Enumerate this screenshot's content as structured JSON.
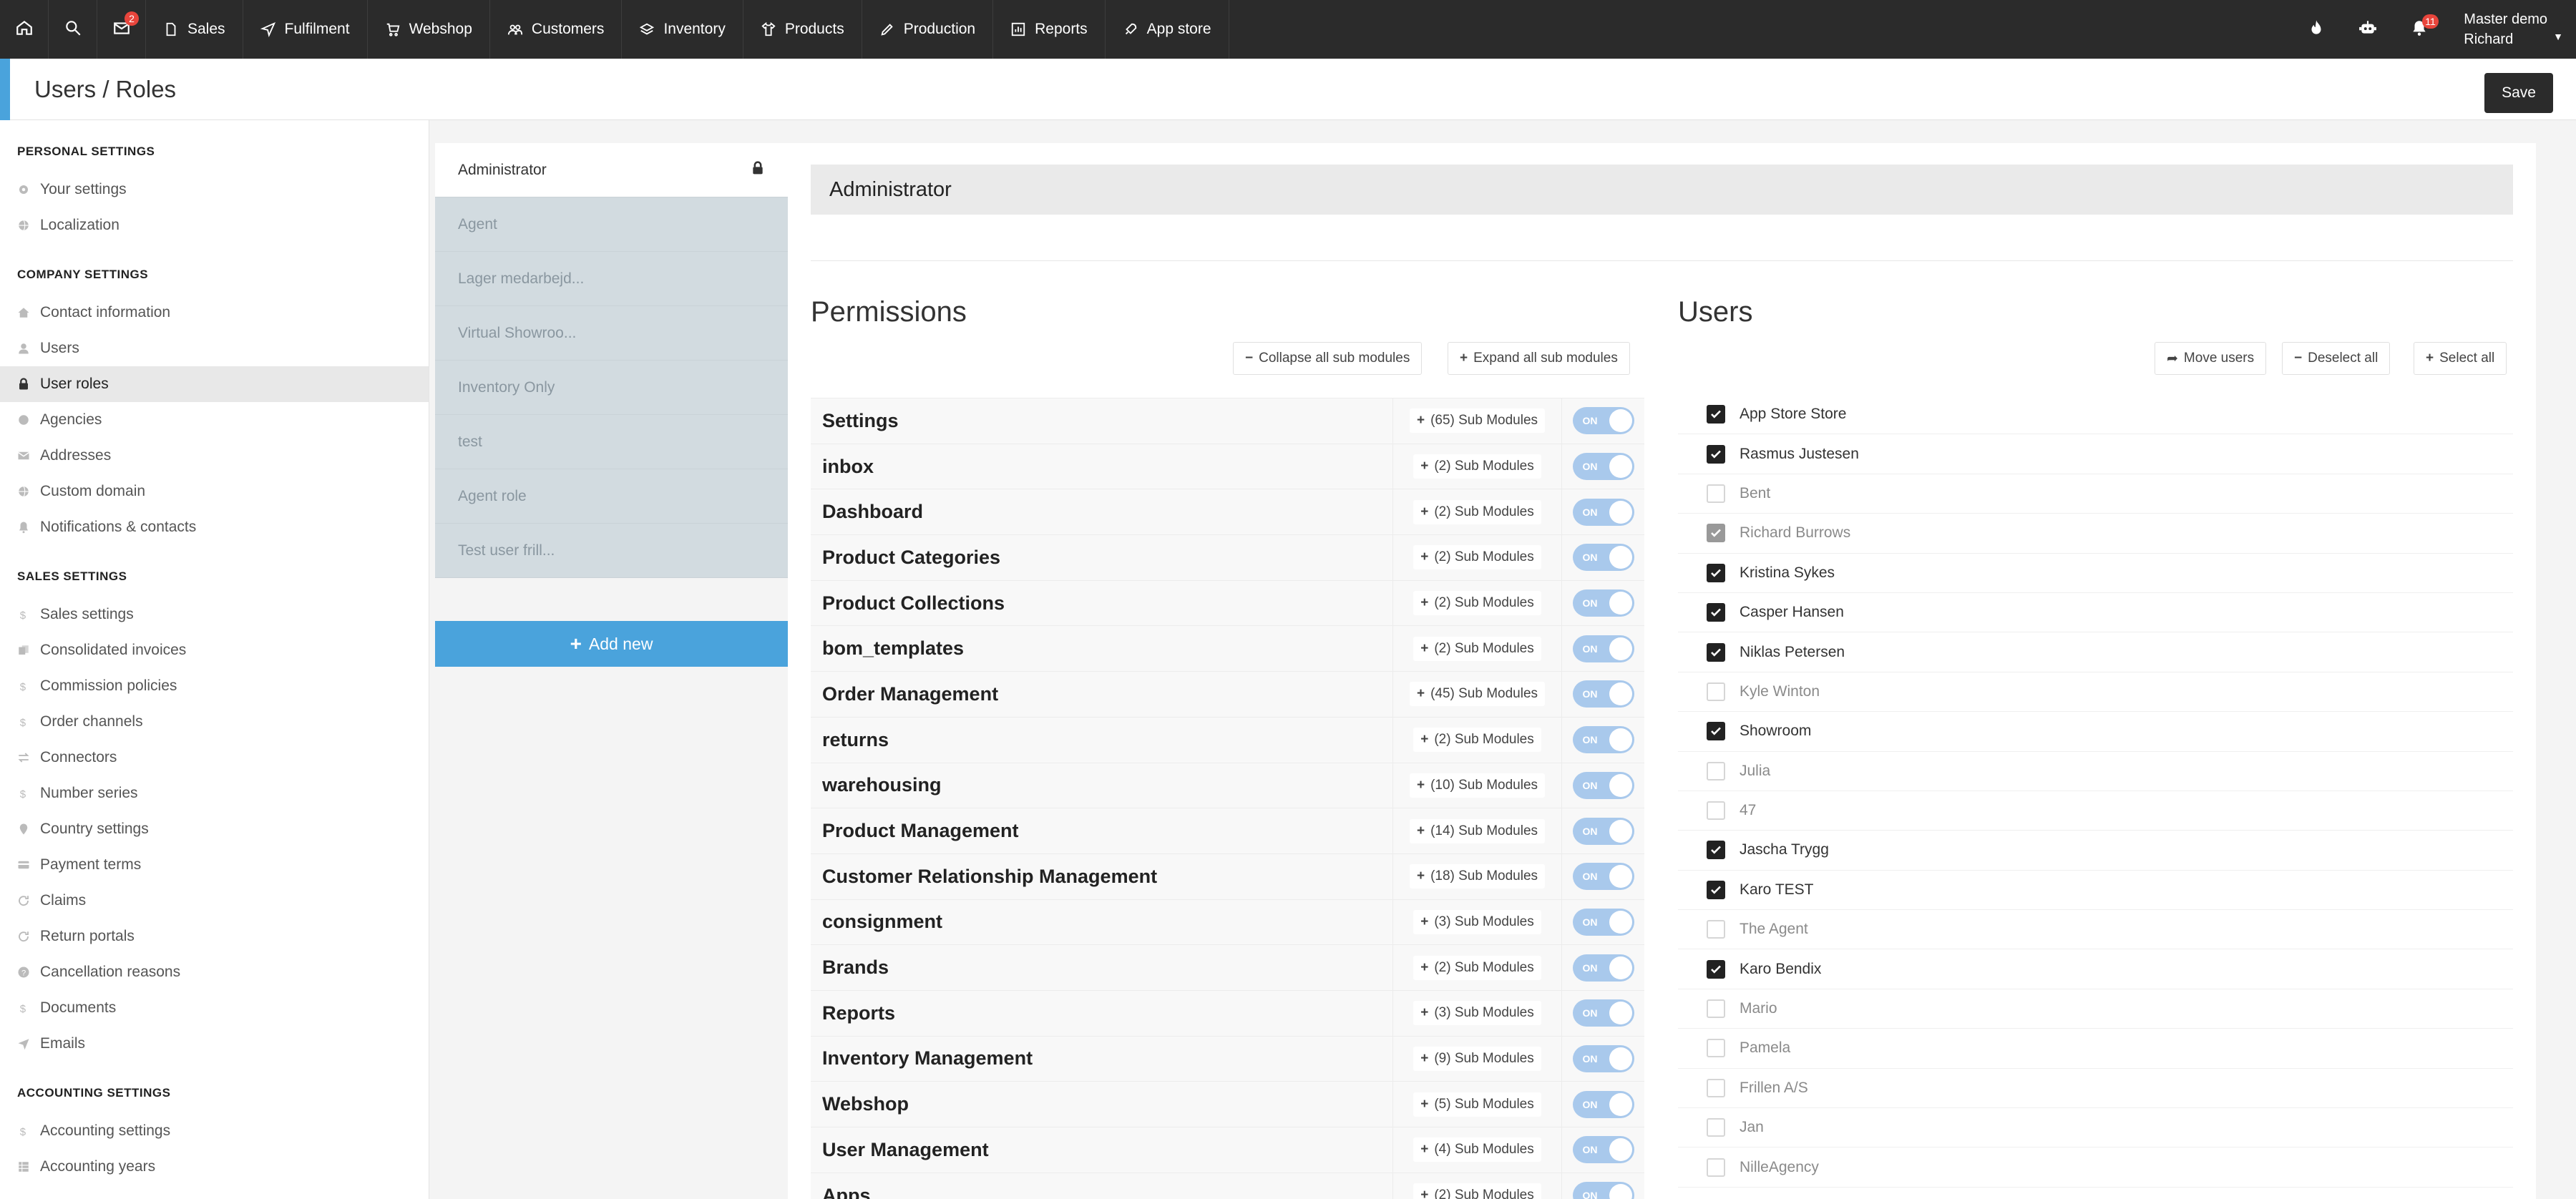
{
  "nav": {
    "mail_badge": "2",
    "items": [
      {
        "label": "Sales",
        "icon": "document-icon"
      },
      {
        "label": "Fulfilment",
        "icon": "paper-plane-icon"
      },
      {
        "label": "Webshop",
        "icon": "cart-icon"
      },
      {
        "label": "Customers",
        "icon": "users-icon"
      },
      {
        "label": "Inventory",
        "icon": "layers-icon"
      },
      {
        "label": "Products",
        "icon": "shirt-icon"
      },
      {
        "label": "Production",
        "icon": "pencil-icon"
      },
      {
        "label": "Reports",
        "icon": "chart-icon"
      },
      {
        "label": "App store",
        "icon": "rocket-icon"
      }
    ],
    "notif_badge": "11",
    "company": "Master demo",
    "user": "Richard"
  },
  "header": {
    "title": "Users / Roles",
    "save_label": "Save"
  },
  "sidebar": {
    "sections": [
      {
        "title": "PERSONAL SETTINGS",
        "items": [
          {
            "label": "Your settings",
            "icon": "gear-icon"
          },
          {
            "label": "Localization",
            "icon": "globe-icon"
          }
        ]
      },
      {
        "title": "COMPANY SETTINGS",
        "items": [
          {
            "label": "Contact information",
            "icon": "home-icon"
          },
          {
            "label": "Users",
            "icon": "user-icon"
          },
          {
            "label": "User roles",
            "icon": "lock-icon",
            "active": true
          },
          {
            "label": "Agencies",
            "icon": "circle-icon"
          },
          {
            "label": "Addresses",
            "icon": "envelope-icon"
          },
          {
            "label": "Custom domain",
            "icon": "globe-icon"
          },
          {
            "label": "Notifications & contacts",
            "icon": "bell-icon"
          }
        ]
      },
      {
        "title": "SALES SETTINGS",
        "items": [
          {
            "label": "Sales settings",
            "icon": "dollar-icon"
          },
          {
            "label": "Consolidated invoices",
            "icon": "invoice-icon"
          },
          {
            "label": "Commission policies",
            "icon": "dollar-icon"
          },
          {
            "label": "Order channels",
            "icon": "dollar-icon"
          },
          {
            "label": "Connectors",
            "icon": "exchange-icon"
          },
          {
            "label": "Number series",
            "icon": "dollar-icon"
          },
          {
            "label": "Country settings",
            "icon": "map-pin-icon"
          },
          {
            "label": "Payment terms",
            "icon": "card-icon"
          },
          {
            "label": "Claims",
            "icon": "refresh-icon"
          },
          {
            "label": "Return portals",
            "icon": "refresh-icon"
          },
          {
            "label": "Cancellation reasons",
            "icon": "question-icon"
          },
          {
            "label": "Documents",
            "icon": "dollar-icon"
          },
          {
            "label": "Emails",
            "icon": "send-icon"
          }
        ]
      },
      {
        "title": "ACCOUNTING SETTINGS",
        "items": [
          {
            "label": "Accounting settings",
            "icon": "dollar-icon"
          },
          {
            "label": "Accounting years",
            "icon": "table-icon"
          }
        ]
      }
    ]
  },
  "roles": {
    "items": [
      "Administrator",
      "Agent",
      "Lager medarbejd...",
      "Virtual Showroo...",
      "Inventory Only",
      "test",
      "Agent role",
      "Test user frill..."
    ],
    "add_new_label": "Add new"
  },
  "main": {
    "role_name": "Administrator",
    "permissions_title": "Permissions",
    "collapse_label": "Collapse all sub modules",
    "expand_label": "Expand all sub modules",
    "toggle_label": "ON",
    "permissions": [
      {
        "name": "Settings",
        "sub": "(65) Sub Modules"
      },
      {
        "name": "inbox",
        "sub": "(2) Sub Modules"
      },
      {
        "name": "Dashboard",
        "sub": "(2) Sub Modules"
      },
      {
        "name": "Product Categories",
        "sub": "(2) Sub Modules"
      },
      {
        "name": "Product Collections",
        "sub": "(2) Sub Modules"
      },
      {
        "name": "bom_templates",
        "sub": "(2) Sub Modules"
      },
      {
        "name": "Order Management",
        "sub": "(45) Sub Modules"
      },
      {
        "name": "returns",
        "sub": "(2) Sub Modules"
      },
      {
        "name": "warehousing",
        "sub": "(10) Sub Modules"
      },
      {
        "name": "Product Management",
        "sub": "(14) Sub Modules"
      },
      {
        "name": "Customer Relationship Management",
        "sub": "(18) Sub Modules"
      },
      {
        "name": "consignment",
        "sub": "(3) Sub Modules"
      },
      {
        "name": "Brands",
        "sub": "(2) Sub Modules"
      },
      {
        "name": "Reports",
        "sub": "(3) Sub Modules"
      },
      {
        "name": "Inventory Management",
        "sub": "(9) Sub Modules"
      },
      {
        "name": "Webshop",
        "sub": "(5) Sub Modules"
      },
      {
        "name": "User Management",
        "sub": "(4) Sub Modules"
      },
      {
        "name": "Apps",
        "sub": "(2) Sub Modules"
      }
    ],
    "users_title": "Users",
    "move_users_label": "Move users",
    "deselect_all_label": "Deselect all",
    "select_all_label": "Select all",
    "users": [
      {
        "name": "App Store Store",
        "checked": true
      },
      {
        "name": "Rasmus Justesen",
        "checked": true
      },
      {
        "name": "Bent",
        "checked": false
      },
      {
        "name": "Richard Burrows",
        "checked": true,
        "disabled": true
      },
      {
        "name": "Kristina Sykes",
        "checked": true
      },
      {
        "name": "Casper Hansen",
        "checked": true
      },
      {
        "name": "Niklas Petersen",
        "checked": true
      },
      {
        "name": "Kyle Winton",
        "checked": false
      },
      {
        "name": "Showroom",
        "checked": true
      },
      {
        "name": "Julia",
        "checked": false
      },
      {
        "name": "47",
        "checked": false
      },
      {
        "name": "Jascha Trygg",
        "checked": true
      },
      {
        "name": "Karo TEST",
        "checked": true
      },
      {
        "name": "The Agent",
        "checked": false
      },
      {
        "name": "Karo Bendix",
        "checked": true
      },
      {
        "name": "Mario",
        "checked": false
      },
      {
        "name": "Pamela",
        "checked": false
      },
      {
        "name": "Frillen A/S",
        "checked": false
      },
      {
        "name": "Jan",
        "checked": false
      },
      {
        "name": "NilleAgency",
        "checked": false
      }
    ]
  }
}
